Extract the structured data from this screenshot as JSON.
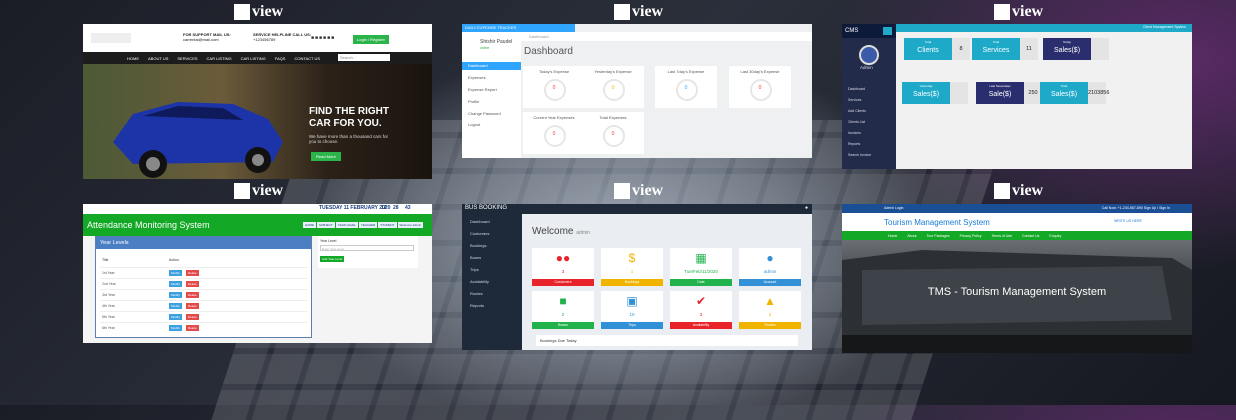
{
  "tiles": [
    {
      "view_label": "view",
      "support_text": "FOR SUPPORT MAIL US:",
      "support_value": "carrental@mail.com",
      "helpline_text": "SERVICE HELPLINE CALL US:",
      "helpline_value": "+123456789",
      "login_button": "Login / Register",
      "nav": [
        "HOME",
        "ABOUT US",
        "SERVICES",
        "CAR LISTING",
        "CAR LISTING",
        "FAQS",
        "CONTACT US"
      ],
      "search_placeholder": "Search...",
      "headline_1": "FIND THE RIGHT",
      "headline_2": "CAR FOR YOU.",
      "subtext": "We have more than a thousand cars for you to choose.",
      "cta": "Read More"
    },
    {
      "view_label": "view",
      "brand": "DAILY EXPENSE TRACKER",
      "user_name": "Shishir Paudel",
      "user_status": "online",
      "breadcrumb": "Dashboard",
      "title": "Dashboard",
      "menu": [
        "Dashboard",
        "Expenses",
        "Expense Report",
        "Profile",
        "Change Password",
        "Logout"
      ],
      "cards": [
        {
          "label": "Today's Expense",
          "value": "0"
        },
        {
          "label": "Yesterday's Expense",
          "value": "0"
        },
        {
          "label": "Last 7day's Expense",
          "value": "0"
        },
        {
          "label": "Last 30day's Expense",
          "value": "0"
        },
        {
          "label": "Current Year Expenses",
          "value": "0"
        },
        {
          "label": "Total Expenses",
          "value": "0"
        }
      ]
    },
    {
      "view_label": "view",
      "brand": "CMS",
      "topbar_right": "Client Management System",
      "admin_name": "Admin",
      "menu": [
        "Dashboard",
        "Services",
        "Add Clients",
        "Clients List",
        "Invoices",
        "Reports",
        "Search Invoice"
      ],
      "stats_row1": [
        {
          "small": "Total",
          "label": "Clients",
          "value": "8"
        },
        {
          "small": "Total",
          "label": "Services",
          "value": "11"
        },
        {
          "small": "Today",
          "label": "Sales($)",
          "value": ""
        }
      ],
      "stats_row2": [
        {
          "small": "Yesterday",
          "label": "Sales($)",
          "value": ""
        },
        {
          "small": "Last Sevendays",
          "label": "Sale($)",
          "value": "250"
        },
        {
          "small": "Total",
          "label": "Sales($)",
          "value": "2103856"
        }
      ]
    },
    {
      "view_label": "view",
      "title": "Attendance Monitoring System",
      "date": "TUESDAY 11 FEBRUARY 2020",
      "time_h": "12",
      "time_m": "28",
      "time_s": "43",
      "nav": [
        "HOME",
        "SUBJECT",
        "YEAR LEVEL",
        "TEACHER",
        "STUDENT",
        "Welcome Admin"
      ],
      "panel_title": "Year Levels",
      "col_title": "Title",
      "col_action": "Action",
      "rows": [
        "1st Year",
        "2nd Year",
        "3rd Year",
        "4th Year",
        "5th Year",
        "6th Year"
      ],
      "modify": "Modify",
      "delete": "Delete",
      "side_label": "Year Level",
      "side_placeholder": "Enter Year Level",
      "side_button": "Add Year Level"
    },
    {
      "view_label": "view",
      "brand": "BUS BOOKING",
      "menu": [
        "Dashboard",
        "Customers",
        "Bookings",
        "Buses",
        "Trips",
        "Availability",
        "Routes",
        "Reports"
      ],
      "welcome": "Welcome",
      "welcome_user": "admin",
      "cards": [
        {
          "value": "3",
          "label": "Customers",
          "color": "#e8232a",
          "bar": "#e8232a",
          "icon": "users-icon"
        },
        {
          "value": "1",
          "label": "Bookings",
          "color": "#f0b400",
          "bar": "#f0b400",
          "icon": "money-icon"
        },
        {
          "value": "Tue/Feb/11/2020",
          "label": "Date",
          "color": "#21b24c",
          "bar": "#21b24c",
          "icon": "calendar-icon"
        },
        {
          "value": "admin",
          "label": "Account",
          "color": "#3190d6",
          "bar": "#3190d6",
          "icon": "user-icon"
        },
        {
          "value": "2",
          "label": "Buses",
          "color": "#21b24c",
          "bar": "#21b24c",
          "icon": "truck-icon"
        },
        {
          "value": "10",
          "label": "Trips",
          "color": "#3190d6",
          "bar": "#3190d6",
          "icon": "sitemap-icon"
        },
        {
          "value": "3",
          "label": "Availability",
          "color": "#e8232a",
          "bar": "#e8232a",
          "icon": "check-icon"
        },
        {
          "value": "2",
          "label": "Routes",
          "color": "#f0b400",
          "bar": "#f0b400",
          "icon": "warning-icon"
        }
      ],
      "footer": "Bookings Due Today"
    },
    {
      "view_label": "view",
      "topbar_left": "Admin Login",
      "topbar_right": "Call Now: +1-234-567-890   Sign Up / Sign In",
      "title": "Tourism Management System",
      "right_action": "WRITE US HERE",
      "nav": [
        "Home",
        "About",
        "Tour Packages",
        "Privacy Policy",
        "Terms of Use",
        "Contact Us",
        "Enquiry"
      ],
      "hero_text": "TMS - Tourism Management System"
    }
  ]
}
